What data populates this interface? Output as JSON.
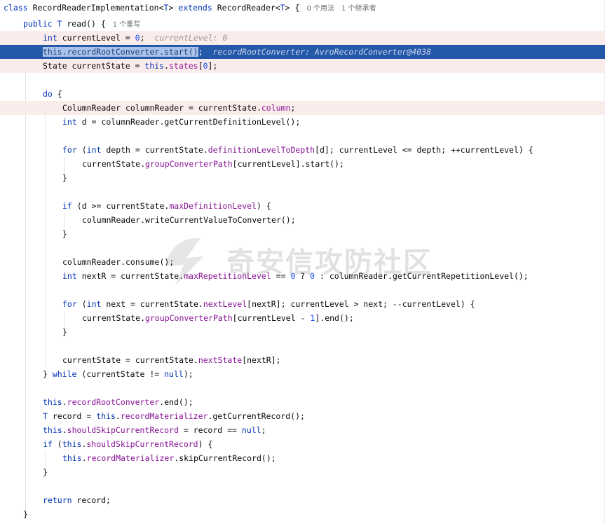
{
  "header": {
    "class_kw": "class",
    "class_name": "RecordReaderImplementation<",
    "class_type": "T",
    "class_name_close": ">",
    "extends_kw": "extends",
    "super_name": "RecordReader<",
    "super_type": "T",
    "super_close": "> {",
    "hint_usages": "0 个用法",
    "hint_inheritors": "1 个继承者"
  },
  "method": {
    "public_kw": "public",
    "return_type": "T",
    "signature": "read() {",
    "hint_overrides": "1 个重写"
  },
  "lines": {
    "l3_kw": "int",
    "l3_a": "currentLevel = ",
    "l3_num": "0",
    "l3_b": ";",
    "l3_inlay": "currentLevel: 0",
    "l4_sel": "this.recordRootConverter.start()",
    "l4_rest": ";",
    "l4_inlay": "recordRootConverter: AvroRecordConverter@4038",
    "l5_a": "State currentState = ",
    "l5_kw": "this",
    "l5_dot": ".",
    "l5_fld": "states",
    "l5_b": "[",
    "l5_num": "0",
    "l5_c": "];",
    "l7_kw": "do",
    "l7_b": " {",
    "l8_a": "ColumnReader columnReader = currentState.",
    "l8_fld": "column",
    "l8_b": ";",
    "l9_kw": "int",
    "l9_a": " d = columnReader.getCurrentDefinitionLevel();",
    "l11_kw1": "for",
    "l11_a": " (",
    "l11_kw2": "int",
    "l11_b": " depth = currentState.",
    "l11_fld": "definitionLevelToDepth",
    "l11_c": "[d]; currentLevel <= depth; ++currentLevel) {",
    "l12_a": "currentState.",
    "l12_fld": "groupConverterPath",
    "l12_b": "[currentLevel].start();",
    "l13": "}",
    "l15_kw": "if",
    "l15_a": " (d >= currentState.",
    "l15_fld": "maxDefinitionLevel",
    "l15_b": ") {",
    "l16": "columnReader.writeCurrentValueToConverter();",
    "l17": "}",
    "l19": "columnReader.consume();",
    "l20_kw": "int",
    "l20_a": " nextR = currentState.",
    "l20_fld": "maxRepetitionLevel",
    "l20_b": " == ",
    "l20_n1": "0",
    "l20_c": " ? ",
    "l20_n2": "0",
    "l20_d": " : columnReader.getCurrentRepetitionLevel();",
    "l22_kw1": "for",
    "l22_a": " (",
    "l22_kw2": "int",
    "l22_b": " next = currentState.",
    "l22_fld": "nextLevel",
    "l22_c": "[nextR]; currentLevel > next; --currentLevel) {",
    "l23_a": "currentState.",
    "l23_fld": "groupConverterPath",
    "l23_b": "[currentLevel - ",
    "l23_num": "1",
    "l23_c": "].end();",
    "l24": "}",
    "l26_a": "currentState = currentState.",
    "l26_fld": "nextState",
    "l26_b": "[nextR];",
    "l27_a": "} ",
    "l27_kw": "while",
    "l27_b": " (currentState != ",
    "l27_kw2": "null",
    "l27_c": ");",
    "l29_kw": "this",
    "l29_dot": ".",
    "l29_fld": "recordRootConverter",
    "l29_b": ".end();",
    "l30_typ": "T",
    "l30_a": " record = ",
    "l30_kw": "this",
    "l30_dot": ".",
    "l30_fld": "recordMaterializer",
    "l30_b": ".getCurrentRecord();",
    "l31_kw": "this",
    "l31_dot": ".",
    "l31_fld": "shouldSkipCurrentRecord",
    "l31_b": " = record == ",
    "l31_kw2": "null",
    "l31_c": ";",
    "l32_kw": "if",
    "l32_a": " (",
    "l32_kw2": "this",
    "l32_dot": ".",
    "l32_fld": "shouldSkipCurrentRecord",
    "l32_b": ") {",
    "l33_kw": "this",
    "l33_dot": ".",
    "l33_fld": "recordMaterializer",
    "l33_b": ".skipCurrentRecord();",
    "l34": "}",
    "l36_kw": "return",
    "l36_a": " record;",
    "l37": "}"
  },
  "watermark": {
    "text": "奇安信攻防社区"
  }
}
